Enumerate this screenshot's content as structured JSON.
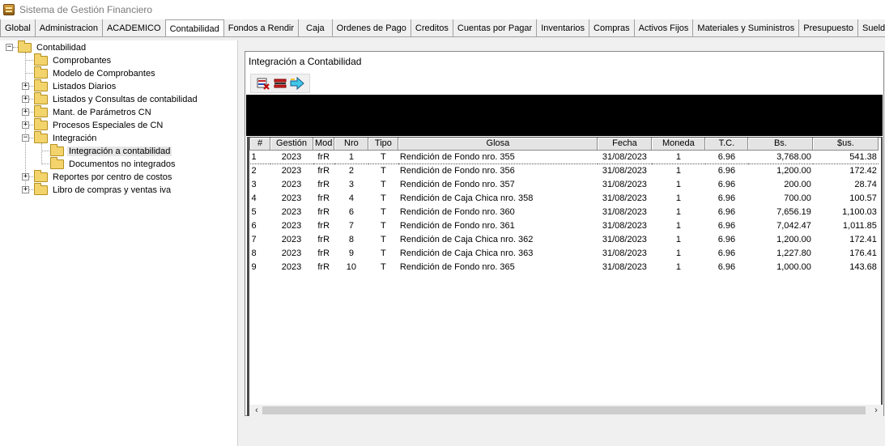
{
  "window": {
    "title": "Sistema de Gestión Financiero"
  },
  "tabs": [
    "Global",
    "Administracion",
    "ACADEMICO",
    "Contabilidad",
    "Fondos a Rendir",
    "Caja",
    "Ordenes de Pago",
    "Creditos",
    "Cuentas por Pagar",
    "Inventarios",
    "Compras",
    "Activos Fijos",
    "Materiales y Suministros",
    "Presupuesto",
    "Sueldos"
  ],
  "active_tab": "Contabilidad",
  "tree": {
    "root": "Contabilidad",
    "items": [
      "Comprobantes",
      "Modelo de Comprobantes",
      "Listados Diarios",
      "Listados y Consultas de contabilidad",
      "Mant. de Parámetros CN",
      "Procesos Especiales de CN",
      "Integración",
      "Integración a contabilidad",
      "Documentos no integrados",
      "Reportes por centro de costos",
      "Libro de compras y ventas iva"
    ]
  },
  "panel": {
    "title": "Integración a Contabilidad",
    "toolbar_icons": [
      "select-remove-icon",
      "delete-row-icon",
      "transfer-arrow-icon"
    ]
  },
  "grid": {
    "columns": [
      "#",
      "Gestión",
      "Mod",
      "Nro",
      "Tipo",
      "Glosa",
      "Fecha",
      "Moneda",
      "T.C.",
      "Bs.",
      "$us."
    ],
    "rows": [
      [
        "1",
        "2023",
        "frR",
        "1",
        "T",
        "Rendición de Fondo nro. 355",
        "31/08/2023",
        "1",
        "6.96",
        "3,768.00",
        "541.38"
      ],
      [
        "2",
        "2023",
        "frR",
        "2",
        "T",
        "Rendición de Fondo nro. 356",
        "31/08/2023",
        "1",
        "6.96",
        "1,200.00",
        "172.42"
      ],
      [
        "3",
        "2023",
        "frR",
        "3",
        "T",
        "Rendición de Fondo nro. 357",
        "31/08/2023",
        "1",
        "6.96",
        "200.00",
        "28.74"
      ],
      [
        "4",
        "2023",
        "frR",
        "4",
        "T",
        "Rendición de Caja Chica nro. 358",
        "31/08/2023",
        "1",
        "6.96",
        "700.00",
        "100.57"
      ],
      [
        "5",
        "2023",
        "frR",
        "6",
        "T",
        "Rendición de Fondo nro. 360",
        "31/08/2023",
        "1",
        "6.96",
        "7,656.19",
        "1,100.03"
      ],
      [
        "6",
        "2023",
        "frR",
        "7",
        "T",
        "Rendición de Fondo nro. 361",
        "31/08/2023",
        "1",
        "6.96",
        "7,042.47",
        "1,011.85"
      ],
      [
        "7",
        "2023",
        "frR",
        "8",
        "T",
        "Rendición de Caja Chica nro. 362",
        "31/08/2023",
        "1",
        "6.96",
        "1,200.00",
        "172.41"
      ],
      [
        "8",
        "2023",
        "frR",
        "9",
        "T",
        "Rendición de Caja Chica nro. 363",
        "31/08/2023",
        "1",
        "6.96",
        "1,227.80",
        "176.41"
      ],
      [
        "9",
        "2023",
        "frR",
        "10",
        "T",
        "Rendición de Fondo nro. 365",
        "31/08/2023",
        "1",
        "6.96",
        "1,000.00",
        "143.68"
      ]
    ]
  }
}
